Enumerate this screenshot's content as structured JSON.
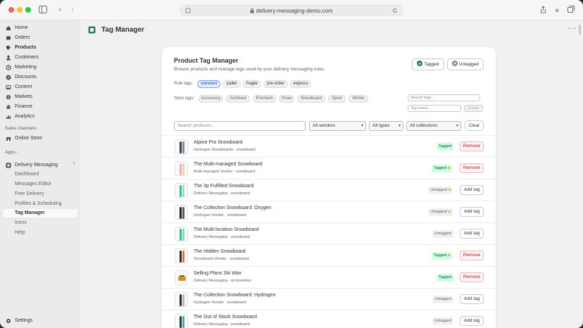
{
  "browser": {
    "url": "delivery-messaging-demo.com"
  },
  "sidebar": {
    "items": [
      {
        "label": "Home",
        "icon": "home-icon"
      },
      {
        "label": "Orders",
        "icon": "orders-icon"
      },
      {
        "label": "Products",
        "icon": "tag-icon"
      },
      {
        "label": "Customers",
        "icon": "person-icon"
      },
      {
        "label": "Marketing",
        "icon": "target-icon"
      },
      {
        "label": "Discounts",
        "icon": "discount-icon"
      },
      {
        "label": "Content",
        "icon": "image-icon"
      },
      {
        "label": "Markets",
        "icon": "globe-icon"
      },
      {
        "label": "Finance",
        "icon": "bank-icon"
      },
      {
        "label": "Analytics",
        "icon": "chart-icon"
      }
    ],
    "sales_channels_label": "Sales channels",
    "online_store_label": "Online Store",
    "apps_label": "Apps",
    "app_name": "Delivery Messaging",
    "app_subitems": [
      "Dashboard",
      "Messages Editor",
      "Free Delivery",
      "Profiles & Scheduling",
      "Tag Manager",
      "Icons",
      "Help"
    ],
    "settings_label": "Settings"
  },
  "header": {
    "title": "Tag Manager"
  },
  "card": {
    "title": "Product Tag Manager",
    "subtitle": "Browse products and manage tags used by your delivery messaging rules.",
    "tagged_button": "Tagged",
    "untagged_button": "Untagged",
    "rule_tags_label": "Rule tags:",
    "rule_tags": [
      "standard",
      "pallet",
      "fragile",
      "pre-order",
      "express"
    ],
    "store_tags_label": "Store tags:",
    "store_tags": [
      "Accessory",
      "Archived",
      "Premium",
      "Snow",
      "Snowboard",
      "Sport",
      "Winter"
    ],
    "search_tags_placeholder": "Search tags...",
    "tag_name_placeholder": "Tag name...",
    "create_label": "Create",
    "search_products_placeholder": "Search products...",
    "vendors_select": "All vendors",
    "types_select": "All types",
    "collections_select": "All collections",
    "clear_label": "Clear"
  },
  "products": [
    {
      "name": "Alpine Pro Snowboard",
      "meta": "Hydrogen Snowboards · snowboard",
      "status": "Tagged",
      "dot": false,
      "action": "Remove"
    },
    {
      "name": "The Multi-managed Snowboard",
      "meta": "Multi-managed Vendor · snowboard",
      "status": "Tagged",
      "dot": true,
      "action": "Remove"
    },
    {
      "name": "The 3p Fulfilled Snowboard",
      "meta": "Delivery Messaging · snowboard",
      "status": "Untagged",
      "dot": true,
      "action": "Add tag"
    },
    {
      "name": "The Collection Snowboard: Oxygen",
      "meta": "Hydrogen Vendor · snowboard",
      "status": "Untagged",
      "dot": true,
      "action": "Add tag"
    },
    {
      "name": "The Multi-location Snowboard",
      "meta": "Delivery Messaging · snowboard",
      "status": "Untagged",
      "dot": false,
      "action": "Add tag"
    },
    {
      "name": "The Hidden Snowboard",
      "meta": "Snowboard Vendor · snowboard",
      "status": "Tagged",
      "dot": true,
      "action": "Remove"
    },
    {
      "name": "Selling Plans Ski Wax",
      "meta": "Delivery Messaging · accessories",
      "status": "Tagged",
      "dot": false,
      "action": "Remove"
    },
    {
      "name": "The Collection Snowboard: Hydrogen",
      "meta": "Hydrogen Vendor · snowboard",
      "status": "Untagged",
      "dot": false,
      "action": "Add tag"
    },
    {
      "name": "The Out of Stock Snowboard",
      "meta": "Delivery Messaging · snowboard",
      "status": "Untagged",
      "dot": false,
      "action": "Add tag"
    }
  ],
  "colors": {
    "tagged_bg": "#cdfee1",
    "remove_text": "#c70a24",
    "selected_tag": "#e3efff"
  }
}
